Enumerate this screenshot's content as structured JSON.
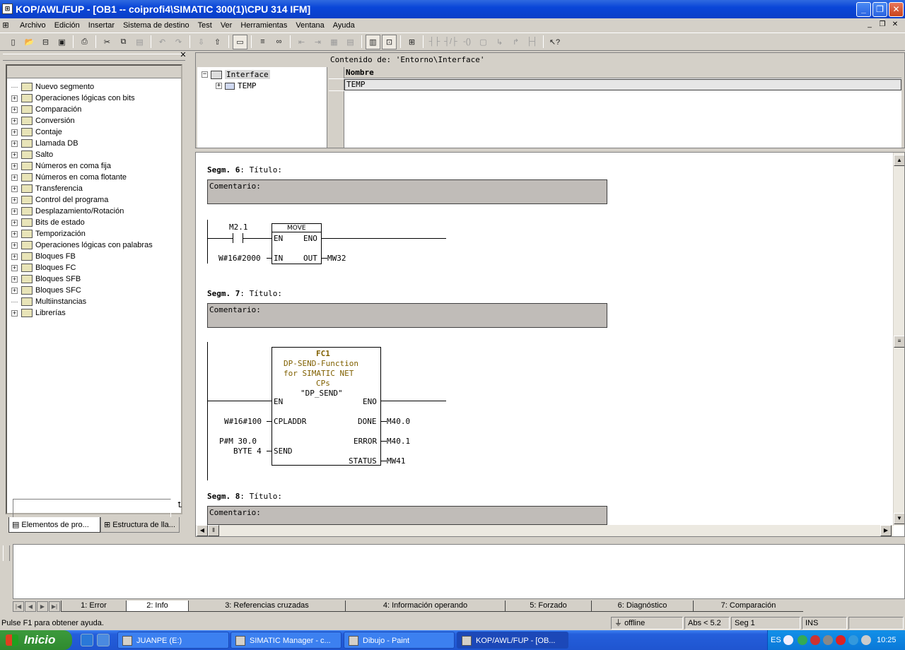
{
  "window": {
    "title": "KOP/AWL/FUP  - [OB1 -- coiprofi4\\SIMATIC 300(1)\\CPU 314 IFM]",
    "app_icon": "step7-ladder-icon",
    "btn_min": "_",
    "btn_max": "❐",
    "btn_close": "✕"
  },
  "menu": {
    "items": [
      "Archivo",
      "Edición",
      "Insertar",
      "Sistema de destino",
      "Test",
      "Ver",
      "Herramientas",
      "Ventana",
      "Ayuda"
    ],
    "mdi_min": "_",
    "mdi_restore": "❐",
    "mdi_close": "✕"
  },
  "toolbar": {
    "icons": [
      "new-icon",
      "open-icon",
      "accessible-nodes-icon",
      "save-icon",
      "print-icon",
      "cut-icon",
      "copy-icon",
      "paste-icon",
      "undo-icon",
      "redo-icon",
      "download-icon",
      "upload-icon",
      "overview-icon",
      "segment-icon",
      "monitor-icon",
      "glasses-icon",
      "jump-prev-icon",
      "jump-next-icon",
      "panel-icon",
      "details-icon",
      "new-segment-icon",
      "contact-no-icon",
      "contact-nc-icon",
      "coil-icon",
      "branch-open-icon",
      "branch-close-icon",
      "connection-icon",
      "help-icon"
    ]
  },
  "left_panel": {
    "close": "✕",
    "tree": [
      {
        "label": "Nuevo segmento",
        "expandable": false,
        "icon": "new-segment-icon"
      },
      {
        "label": "Operaciones lógicas con bits",
        "expandable": true,
        "icon": "bit-logic-icon"
      },
      {
        "label": "Comparación",
        "expandable": true,
        "icon": "comparator-icon"
      },
      {
        "label": "Conversión",
        "expandable": true,
        "icon": "converter-icon"
      },
      {
        "label": "Contaje",
        "expandable": true,
        "icon": "counter-icon"
      },
      {
        "label": "Llamada DB",
        "expandable": true,
        "icon": "db-call-icon"
      },
      {
        "label": "Salto",
        "expandable": true,
        "icon": "jump-icon"
      },
      {
        "label": "Números en coma fija",
        "expandable": true,
        "icon": "integer-math-icon"
      },
      {
        "label": "Números en coma flotante",
        "expandable": true,
        "icon": "float-math-icon"
      },
      {
        "label": "Transferencia",
        "expandable": true,
        "icon": "move-icon"
      },
      {
        "label": "Control del programa",
        "expandable": true,
        "icon": "program-control-icon"
      },
      {
        "label": "Desplazamiento/Rotación",
        "expandable": true,
        "icon": "shift-rotate-icon"
      },
      {
        "label": "Bits de estado",
        "expandable": true,
        "icon": "status-bits-icon"
      },
      {
        "label": "Temporización",
        "expandable": true,
        "icon": "timer-icon"
      },
      {
        "label": "Operaciones lógicas con palabras",
        "expandable": true,
        "icon": "word-logic-icon"
      },
      {
        "label": "Bloques FB",
        "expandable": true,
        "icon": "fb-blocks-icon"
      },
      {
        "label": "Bloques FC",
        "expandable": true,
        "icon": "fc-blocks-icon"
      },
      {
        "label": "Bloques SFB",
        "expandable": true,
        "icon": "sfb-blocks-icon"
      },
      {
        "label": "Bloques SFC",
        "expandable": true,
        "icon": "sfc-blocks-icon"
      },
      {
        "label": "Multiinstancias",
        "expandable": false,
        "icon": "multiinstance-icon"
      },
      {
        "label": "Librerías",
        "expandable": true,
        "icon": "libraries-icon"
      }
    ],
    "tab1": "Elementos de pro...",
    "tab2": "Estructura de lla..."
  },
  "interface": {
    "root": "Interface",
    "child": "TEMP",
    "content_title": "Contenido de: 'Entorno\\Interface'",
    "col_header": "Nombre",
    "row1": "TEMP"
  },
  "editor": {
    "seg6": {
      "label": "Segm. 6",
      "title": ": Título:",
      "comment": "Comentario:",
      "contact": "M2.1",
      "box": "MOVE",
      "en": "EN",
      "eno": "ENO",
      "in_pin": "IN",
      "out_pin": "OUT",
      "in_val": "W#16#2000",
      "out_val": "MW32"
    },
    "seg7": {
      "label": "Segm. 7",
      "title": ": Título:",
      "comment": "Comentario:",
      "fc": "FC1",
      "desc1": "DP-SEND-Function",
      "desc2": "for  SIMATIC NET",
      "desc3": "CPs",
      "name": "\"DP_SEND\"",
      "en": "EN",
      "eno": "ENO",
      "p_cpladdr": "CPLADDR",
      "v_cpladdr": "W#16#100",
      "p_send": "SEND",
      "v_send1": "P#M 30.0",
      "v_send2": "BYTE 4",
      "p_done": "DONE",
      "v_done": "M40.0",
      "p_error": "ERROR",
      "v_error": "M40.1",
      "p_status": "STATUS",
      "v_status": "MW41"
    },
    "seg8": {
      "label": "Segm. 8",
      "title": ": Título:",
      "comment": "Comentario:"
    }
  },
  "output": {
    "tabs": [
      "1: Error",
      "2: Info",
      "3: Referencias cruzadas",
      "4: Información operando",
      "5: Forzado",
      "6: Diagnóstico",
      "7: Comparación"
    ],
    "active_tab": "2: Info"
  },
  "status": {
    "help": "Pulse F1 para obtener ayuda.",
    "mode": "offline",
    "abs": "Abs < 5.2",
    "seg": "Seg 1",
    "ins": "INS"
  },
  "taskbar": {
    "start": "Inicio",
    "tasks": [
      "JUANPE (E:)",
      "SIMATIC Manager - c...",
      "Dibujo - Paint",
      "KOP/AWL/FUP  - [OB..."
    ],
    "lang": "ES",
    "clock": "10:25"
  }
}
